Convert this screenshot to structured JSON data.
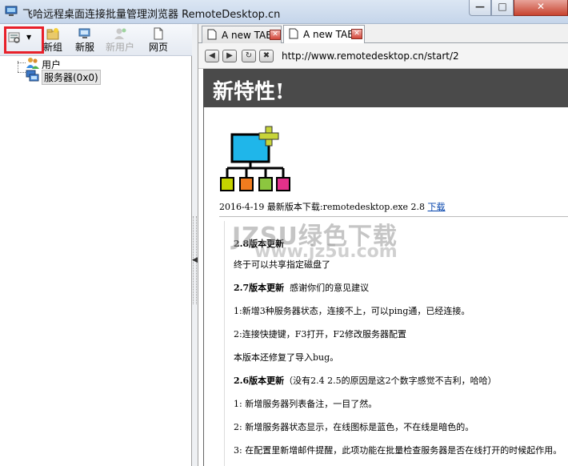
{
  "window": {
    "title": "飞哈远程桌面连接批量管理浏览器 RemoteDesktop.cn",
    "minimize_glyph": "—",
    "maximize_glyph": "□",
    "close_glyph": "✕"
  },
  "toolbar": {
    "new_group": "新组",
    "new_server": "新服",
    "new_user": "新用户",
    "web_page": "网页",
    "dropdown_caret": "▼"
  },
  "tree": {
    "user_node": "用户",
    "server_node": "服务器(0x0)"
  },
  "splitter": {
    "arrow": "◀"
  },
  "tabs": [
    {
      "label": "A new TAB",
      "active": false,
      "close": "✕"
    },
    {
      "label": "A new TAB",
      "active": true,
      "close": "✕"
    }
  ],
  "nav": {
    "back": "◀",
    "forward": "▶",
    "refresh": "↻",
    "stop": "✖",
    "url": "http://www.remotedesktop.cn/start/2"
  },
  "page": {
    "heading": "新特性!",
    "release_text": "2016-4-19 最新版本下载:remotedesktop.exe 2.8",
    "download_link": "下载",
    "watermark_main": "JZSU绿色下载",
    "watermark_sub": "www.jz5u.com",
    "notes": {
      "v28_title": "2.8版本更新",
      "v28_line1": "终于可以共享指定磁盘了",
      "v27_title": "2.7版本更新",
      "v27_tail": "感谢你们的意见建议",
      "v27_line1": "1:新增3种服务器状态，连接不上，可以ping通，已经连接。",
      "v27_line2": "2:连接快捷键，F3打开，F2修改服务器配置",
      "v27_line3": "本版本还修复了导入bug。",
      "v26_title": "2.6版本更新",
      "v26_tail": "（没有2.4 2.5的原因是这2个数字感觉不吉利，哈哈）",
      "v26_line1": "1:    新增服务器列表备注，一目了然。",
      "v26_line2": "2:    新增服务器状态显示，在线图标是蓝色，不在线是暗色的。",
      "v26_line3": "3: 在配置里新增邮件提醒，此项功能在批量检查服务器是否在线打开的时候起作用。"
    }
  },
  "colors": {
    "highlight_border": "#e8202a",
    "header_bg": "#4a4a4a",
    "logo_monitor": "#1fb6ea",
    "logo_plus": "#c7d43a",
    "logo_box_1": "#c6d300",
    "logo_box_2": "#f07c1f",
    "logo_box_3": "#8cc63f",
    "logo_box_4": "#e2318a",
    "link": "#0645ad"
  }
}
